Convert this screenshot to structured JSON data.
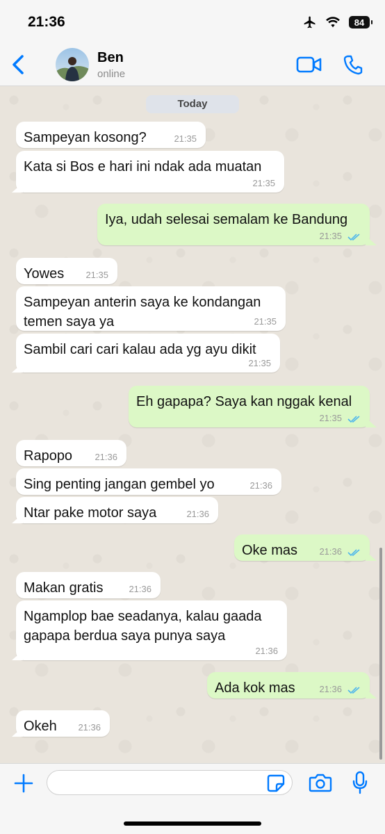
{
  "status_bar": {
    "time": "21:36",
    "battery": "84"
  },
  "header": {
    "name": "Ben",
    "status": "online"
  },
  "date_chip": "Today",
  "messages": [
    {
      "dir": "in",
      "text": "Sampeyan kosong?",
      "time": "21:35"
    },
    {
      "dir": "in",
      "text": "Kata si Bos e hari ini ndak ada muatan",
      "time": "21:35"
    },
    {
      "dir": "out",
      "text": "Iya, udah selesai semalam ke Bandung",
      "time": "21:35"
    },
    {
      "dir": "in",
      "text": "Yowes",
      "time": "21:35"
    },
    {
      "dir": "in",
      "text": "Sampeyan anterin saya ke kondangan\ntemen saya ya",
      "time": "21:35"
    },
    {
      "dir": "in",
      "text": "Sambil cari cari kalau ada yg ayu dikit",
      "time": "21:35"
    },
    {
      "dir": "out",
      "text": "Eh gapapa? Saya kan nggak kenal",
      "time": "21:35"
    },
    {
      "dir": "in",
      "text": "Rapopo",
      "time": "21:36"
    },
    {
      "dir": "in",
      "text": "Sing penting jangan gembel yo",
      "time": "21:36"
    },
    {
      "dir": "in",
      "text": "Ntar pake motor saya",
      "time": "21:36"
    },
    {
      "dir": "out",
      "text": "Oke mas",
      "time": "21:36"
    },
    {
      "dir": "in",
      "text": "Makan gratis",
      "time": "21:36"
    },
    {
      "dir": "in",
      "text": "Ngamplop bae seadanya, kalau gaada\ngapapa berdua saya punya saya",
      "time": "21:36"
    },
    {
      "dir": "out",
      "text": "Ada kok mas",
      "time": "21:36"
    },
    {
      "dir": "in",
      "text": "Okeh",
      "time": "21:36"
    }
  ],
  "input": {
    "value": "",
    "placeholder": ""
  },
  "colors": {
    "accent": "#007aff",
    "outgoing_bubble": "#dcf8c6",
    "incoming_bubble": "#ffffff",
    "read_ticks": "#4fb6ec"
  },
  "icons": {
    "back": "chevron-left-icon",
    "video": "video-camera-icon",
    "phone": "phone-icon",
    "plus": "plus-icon",
    "sticker": "sticker-icon",
    "camera": "camera-icon",
    "mic": "microphone-icon",
    "airplane": "airplane-icon",
    "wifi": "wifi-icon"
  }
}
